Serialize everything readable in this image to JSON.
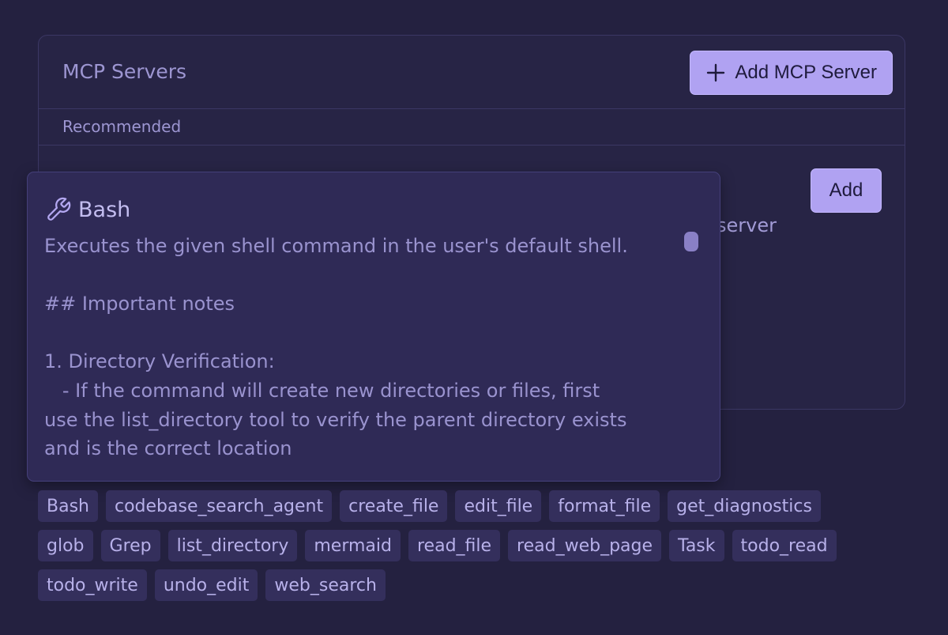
{
  "mcp": {
    "title": "MCP Servers",
    "add_server_label": "Add MCP Server",
    "recommended_label": "Recommended",
    "recommended_item": {
      "add_label": "Add",
      "description_fragment": "server"
    }
  },
  "tooltip": {
    "title": "Bash",
    "body": "Executes the given shell command in the user's default shell.\n\n## Important notes\n\n1. Directory Verification:\n   - If the command will create new directories or files, first\nuse the list_directory tool to verify the parent directory exists\nand is the correct location"
  },
  "tools": {
    "rows": [
      [
        "Bash",
        "codebase_search_agent",
        "create_file",
        "edit_file",
        "format_file",
        "get_diagnostics"
      ],
      [
        "glob",
        "Grep",
        "list_directory",
        "mermaid",
        "read_file",
        "read_web_page",
        "Task",
        "todo_read"
      ],
      [
        "todo_write",
        "undo_edit",
        "web_search"
      ]
    ]
  },
  "icons": {
    "add_server": "plus-icon",
    "tooltip": "wrench-icon"
  },
  "colors": {
    "background": "#242140",
    "accent": "#b0a2f2",
    "chip": "#342f5c"
  }
}
